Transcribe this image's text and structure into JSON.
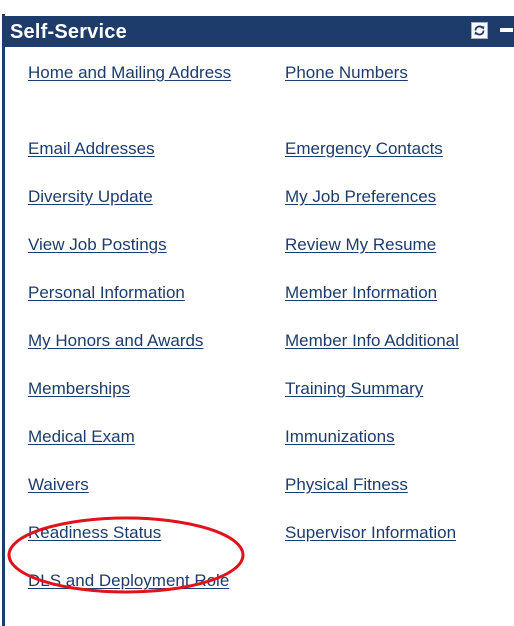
{
  "header": {
    "title": "Self-Service",
    "refresh_icon": "refresh-icon",
    "minimize_icon": "minimize-icon"
  },
  "links": {
    "home_mailing_address": "Home and Mailing Address",
    "phone_numbers": "Phone Numbers",
    "email_addresses": "Email Addresses",
    "emergency_contacts": "Emergency Contacts",
    "diversity_update": "Diversity Update",
    "my_job_preferences": "My Job Preferences",
    "view_job_postings": "View Job Postings",
    "review_my_resume": "Review My Resume",
    "personal_information": "Personal Information",
    "member_information": "Member Information",
    "my_honors_and_awards": "My Honors and Awards",
    "member_info_additional": "Member Info Additional",
    "memberships": "Memberships",
    "training_summary": "Training Summary",
    "medical_exam": "Medical Exam",
    "immunizations": "Immunizations",
    "waivers": "Waivers",
    "physical_fitness": "Physical Fitness",
    "readiness_status": "Readiness Status",
    "supervisor_information": "Supervisor Information",
    "dls_and_deployment_role": "DLS and Deployment Role"
  },
  "colors": {
    "header_bg": "#1d3c6c",
    "link": "#1d3c6c",
    "highlight": "#e0121b"
  }
}
